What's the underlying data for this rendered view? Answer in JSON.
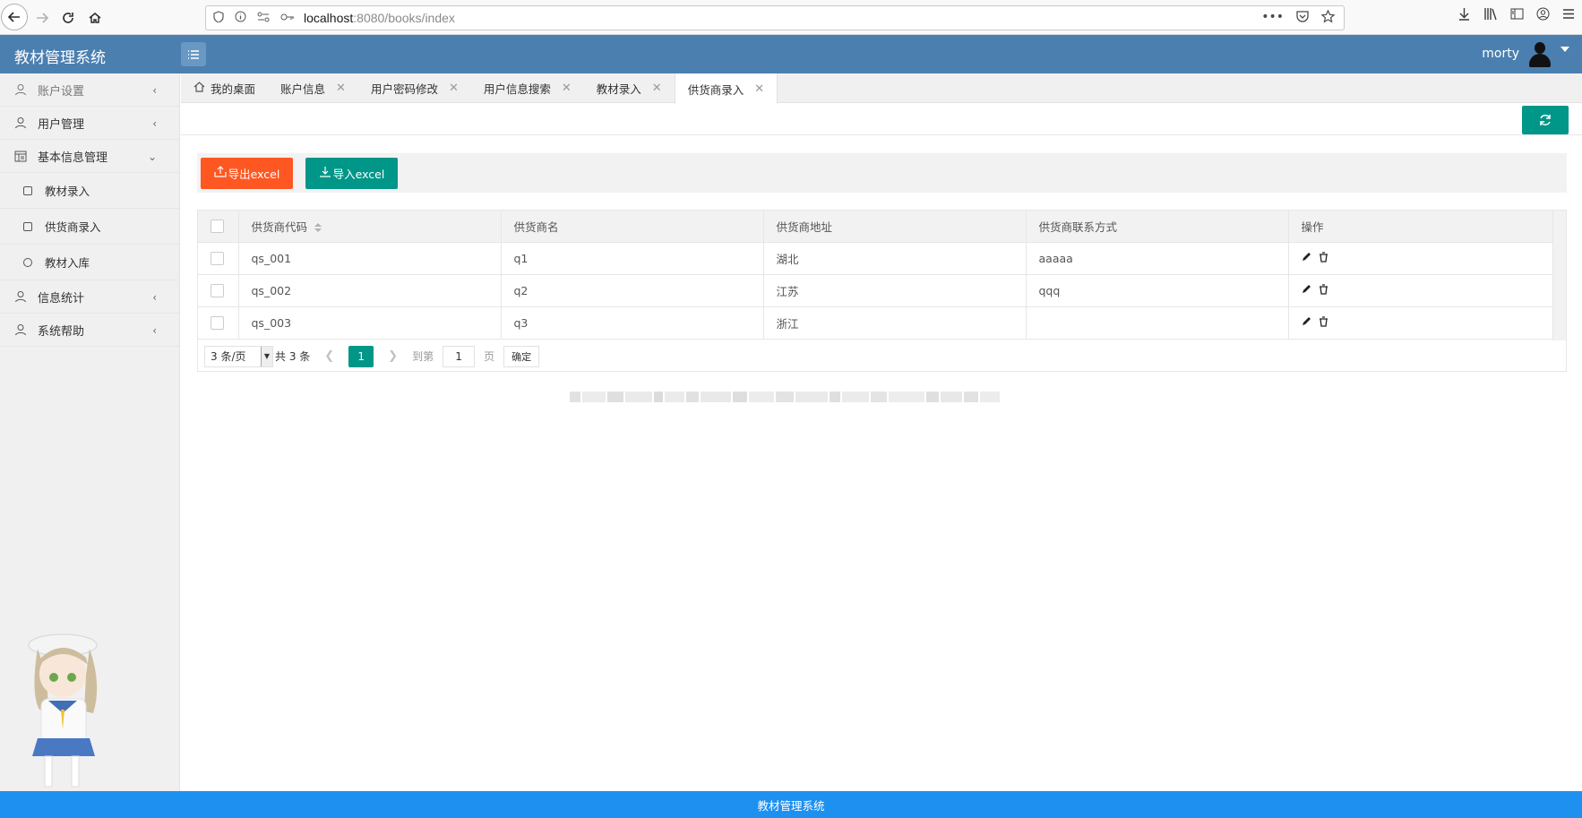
{
  "browser": {
    "url_host": "localhost",
    "url_rest": ":8080/books/index"
  },
  "header": {
    "app_title": "教材管理系统",
    "username": "morty"
  },
  "sidebar": {
    "items": [
      {
        "label": "账户设置"
      },
      {
        "label": "用户管理"
      },
      {
        "label": "基本信息管理"
      },
      {
        "label": "教材录入"
      },
      {
        "label": "供货商录入"
      },
      {
        "label": "教材入库"
      },
      {
        "label": "信息统计"
      },
      {
        "label": "系统帮助"
      }
    ]
  },
  "tabs": [
    {
      "label": "我的桌面"
    },
    {
      "label": "账户信息"
    },
    {
      "label": "用户密码修改"
    },
    {
      "label": "用户信息搜索"
    },
    {
      "label": "教材录入"
    },
    {
      "label": "供货商录入"
    }
  ],
  "toolbar": {
    "export_label": "导出excel",
    "import_label": "导入excel"
  },
  "table": {
    "columns": [
      "供货商代码",
      "供货商名",
      "供货商地址",
      "供货商联系方式",
      "操作"
    ],
    "rows": [
      {
        "code": "qs_001",
        "name": "q1",
        "address": "湖北",
        "contact": "aaaaa"
      },
      {
        "code": "qs_002",
        "name": "q2",
        "address": "江苏",
        "contact": "qqq"
      },
      {
        "code": "qs_003",
        "name": "q3",
        "address": "浙江",
        "contact": ""
      }
    ]
  },
  "pager": {
    "page_size": "3 条/页",
    "total": "共 3 条",
    "current": "1",
    "goto_label": "到第",
    "goto_value": "1",
    "page_unit": "页",
    "confirm": "确定"
  },
  "footer": {
    "text": "教材管理系统"
  },
  "colors": {
    "header_bg": "#4b7fb0",
    "accent_green": "#009688",
    "accent_orange": "#ff5722",
    "footer_bg": "#1e90f0"
  }
}
